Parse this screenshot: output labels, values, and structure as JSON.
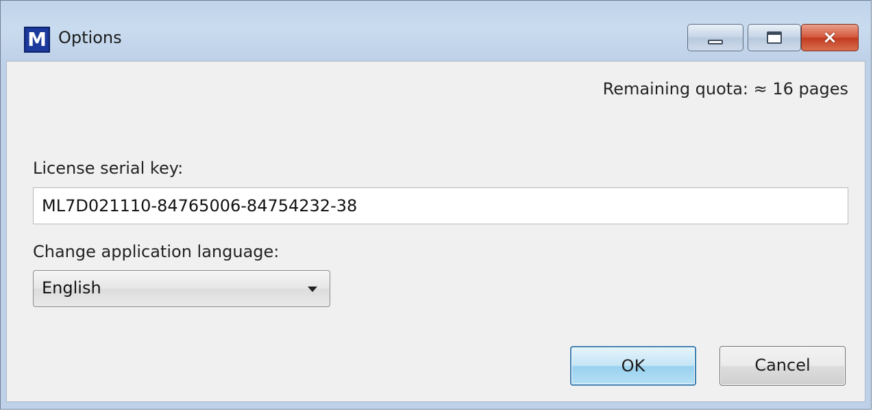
{
  "window": {
    "title": "Options",
    "app_icon_letter": "M",
    "controls": {
      "minimize_icon": "minimize-icon",
      "maximize_icon": "maximize-icon",
      "close_glyph": "×"
    }
  },
  "quota": {
    "text": "Remaining quota: ≈ 16 pages"
  },
  "license": {
    "label": "License serial key:",
    "value": "ML7D021110-84765006-84754232-38"
  },
  "language": {
    "label": "Change application language:",
    "selected": "English"
  },
  "buttons": {
    "ok": "OK",
    "cancel": "Cancel"
  },
  "colors": {
    "titlebar": "#c9dbee",
    "client_bg": "#f0f0f0",
    "ok_border": "#3c7fb1",
    "close_red": "#c23a1f"
  }
}
